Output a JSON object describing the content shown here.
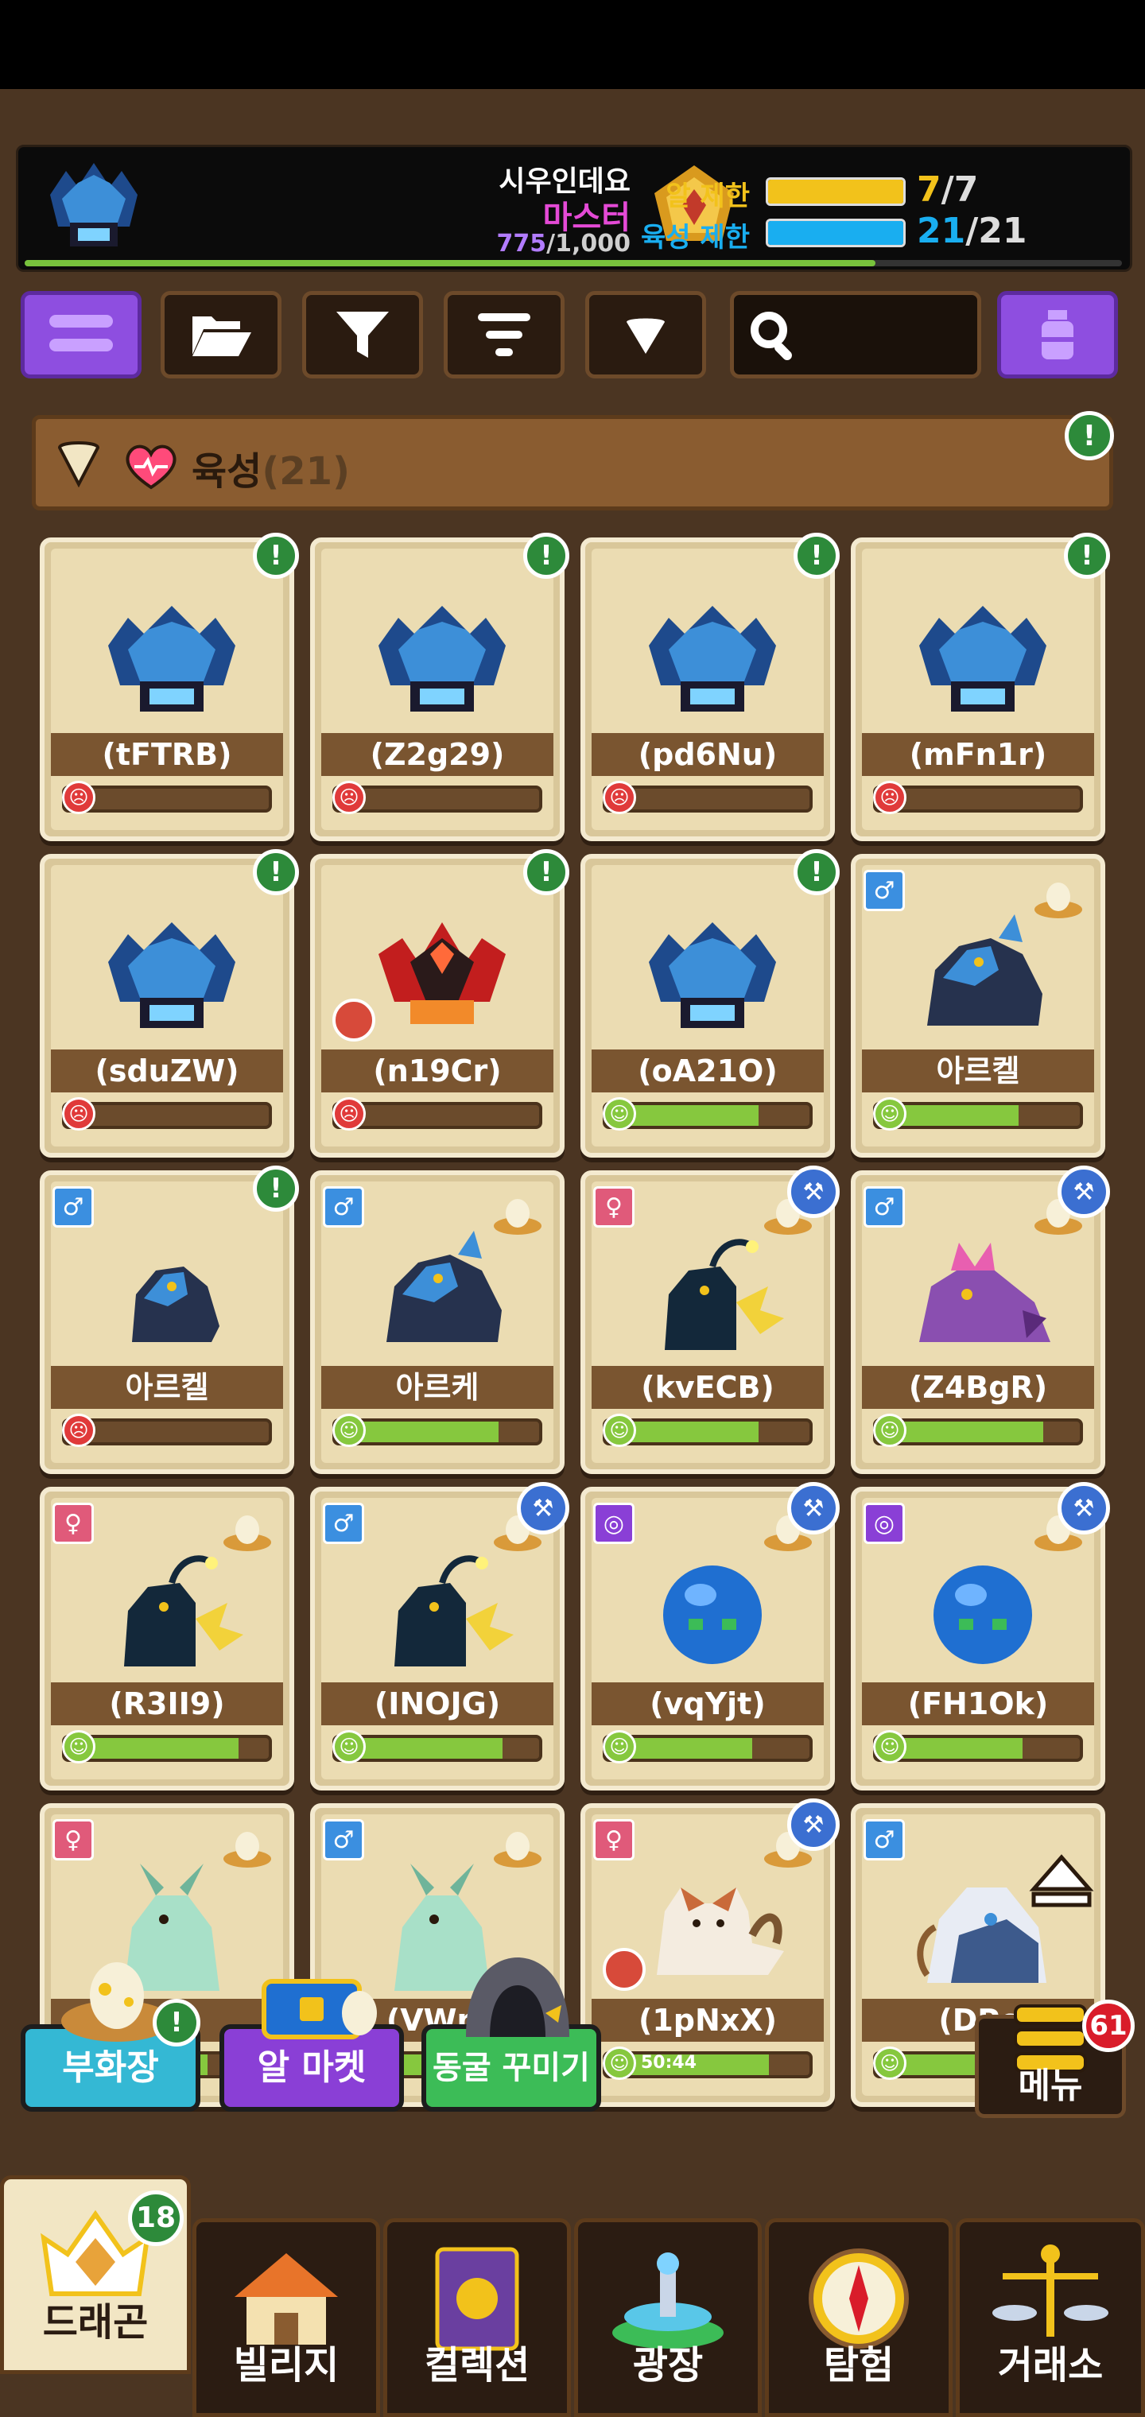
{
  "player": {
    "name": "시우인데요",
    "rank": "마스터",
    "exp_current": "775",
    "exp_max": "/1,000",
    "exp_fraction": 0.775
  },
  "limits": [
    {
      "label": "알 제한",
      "current": "7",
      "max": "/7",
      "color": "#f2c21b"
    },
    {
      "label": "육성 제한",
      "current": "21",
      "max": "/21",
      "color": "#19aef0"
    }
  ],
  "toolbar": {
    "icons": [
      "menu-icon",
      "folder-icon",
      "filter-icon",
      "sort-icon",
      "collapse-icon",
      "search-icon",
      "potion-icon"
    ]
  },
  "group": {
    "label": "육성",
    "count": "(21)"
  },
  "cards": [
    {
      "name": "(tFTRB)",
      "state": "egg",
      "health": 0,
      "mood": "sad",
      "alert": true
    },
    {
      "name": "(Z2g29)",
      "state": "egg",
      "health": 0,
      "mood": "sad",
      "alert": true
    },
    {
      "name": "(pd6Nu)",
      "state": "egg",
      "health": 0,
      "mood": "sad",
      "alert": true
    },
    {
      "name": "(mFn1r)",
      "state": "egg",
      "health": 0,
      "mood": "sad",
      "alert": true
    },
    {
      "name": "(sduZW)",
      "state": "egg",
      "health": 0,
      "mood": "sad",
      "alert": true
    },
    {
      "name": "(n19Cr)",
      "state": "egg-red",
      "health": 0,
      "mood": "sad",
      "alert": true,
      "nobreed": true
    },
    {
      "name": "(oA21O)",
      "state": "egg",
      "health": 0.75,
      "mood": "happy",
      "alert": true
    },
    {
      "name": "아르켈",
      "state": "dragon-blue",
      "health": 0.7,
      "mood": "happy",
      "gender": "male",
      "nest": true
    },
    {
      "name": "아르켈",
      "state": "dragon-blue-small",
      "health": 0,
      "mood": "sad",
      "gender": "male",
      "alert": true
    },
    {
      "name": "아르케",
      "state": "dragon-blue",
      "health": 0.8,
      "mood": "happy",
      "gender": "male",
      "nest": true
    },
    {
      "name": "(kvECB)",
      "state": "dragon-dark",
      "health": 0.75,
      "mood": "happy",
      "gender": "female",
      "nest": true,
      "train": true
    },
    {
      "name": "(Z4BgR)",
      "state": "dragon-purple",
      "health": 0.82,
      "mood": "happy",
      "gender": "male",
      "nest": true,
      "train": true
    },
    {
      "name": "(R3II9)",
      "state": "dragon-dark",
      "health": 0.85,
      "mood": "happy",
      "gender": "female",
      "nest": true
    },
    {
      "name": "(INOJG)",
      "state": "dragon-dark",
      "health": 0.82,
      "mood": "happy",
      "gender": "male",
      "nest": true,
      "train": true
    },
    {
      "name": "(vqYjt)",
      "state": "slime-blue",
      "health": 0.72,
      "mood": "happy",
      "gender": "neutral",
      "nest": true,
      "train": true
    },
    {
      "name": "(FH1Ok)",
      "state": "slime-blue",
      "health": 0.72,
      "mood": "happy",
      "gender": "neutral",
      "nest": true,
      "train": true
    },
    {
      "name": "",
      "state": "dragon-mint",
      "health": 0.7,
      "mood": "happy",
      "gender": "female",
      "nest": true
    },
    {
      "name": "(VWm",
      "state": "dragon-mint",
      "health": 0.7,
      "mood": "happy",
      "gender": "male",
      "nest": true
    },
    {
      "name": "(1pNxX)",
      "state": "cat",
      "health": 0.8,
      "mood": "happy",
      "gender": "female",
      "nest": true,
      "train": true,
      "nobreed": true,
      "timer": "50:44"
    },
    {
      "name": "(DPc",
      "state": "dragon-white",
      "health": 0.5,
      "mood": "happy",
      "gender": "male"
    }
  ],
  "quick_actions": [
    {
      "label": "부화장",
      "color": "#34b8d4",
      "alert": true
    },
    {
      "label": "알 마켓",
      "color": "#8a3fd6"
    },
    {
      "label": "동굴 꾸미기",
      "color": "#3cbc57"
    }
  ],
  "menu": {
    "label": "메뉴",
    "badge": "61"
  },
  "nav": [
    {
      "label": "드래곤",
      "badge": "18",
      "active": true
    },
    {
      "label": "빌리지"
    },
    {
      "label": "컬렉션"
    },
    {
      "label": "광장"
    },
    {
      "label": "탐험"
    },
    {
      "label": "거래소"
    }
  ]
}
